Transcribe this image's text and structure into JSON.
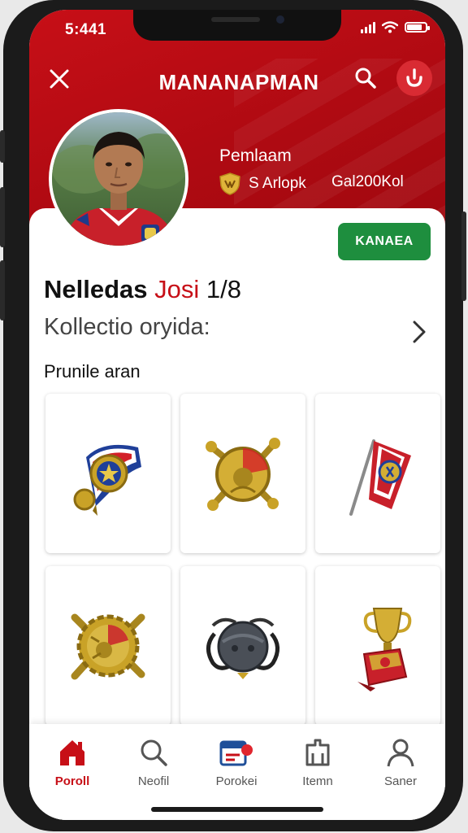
{
  "status_bar": {
    "time": "5:441"
  },
  "header": {
    "title": "MANANAPMAN",
    "close_icon": "close-icon",
    "search_icon": "search-icon",
    "profile_action_icon": "user-badge-icon"
  },
  "profile": {
    "name": "Pemlaam",
    "badge_icon": "shield-badge-icon",
    "rank": "S Arlopk",
    "extra": "Gal200Kol"
  },
  "action_button": {
    "label": "KANAEA",
    "color": "#1e8e3e"
  },
  "collection": {
    "title_bold": "Nelledas",
    "title_accent": "Josi",
    "title_count": "1/8",
    "subtitle": "Kollectio oryida:",
    "profile_label": "Prunile aran"
  },
  "items": [
    {
      "name": "ribbon-medal-item"
    },
    {
      "name": "gold-emblem-item"
    },
    {
      "name": "pennant-flag-item"
    },
    {
      "name": "gear-medallion-item"
    },
    {
      "name": "helmet-item"
    },
    {
      "name": "trophy-item"
    }
  ],
  "nav": [
    {
      "label": "Poroll",
      "icon": "home-icon",
      "active": true
    },
    {
      "label": "Neofil",
      "icon": "search-icon",
      "active": false
    },
    {
      "label": "Porokei",
      "icon": "card-icon",
      "active": false
    },
    {
      "label": "Itemn",
      "icon": "bag-icon",
      "active": false
    },
    {
      "label": "Saner",
      "icon": "person-icon",
      "active": false
    }
  ],
  "colors": {
    "brand_red": "#c70f17",
    "green": "#1e8e3e",
    "gold": "#c9a227"
  }
}
